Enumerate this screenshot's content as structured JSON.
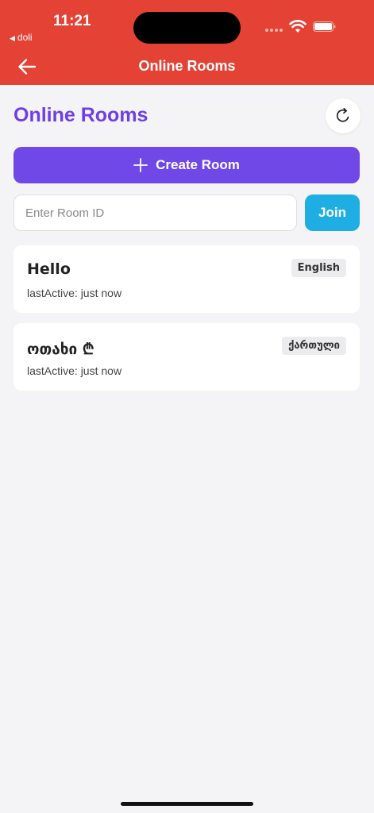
{
  "status_bar": {
    "time": "11:21",
    "back_app": "doli"
  },
  "nav": {
    "title": "Online Rooms",
    "back_icon": "arrow-left-icon"
  },
  "page": {
    "title": "Online Rooms",
    "refresh_icon": "refresh-icon"
  },
  "actions": {
    "create_label": "Create Room",
    "room_id_placeholder": "Enter Room ID",
    "room_id_value": "",
    "join_label": "Join"
  },
  "rooms": [
    {
      "name": "Hello",
      "language": "English",
      "last_active": "lastActive: just now"
    },
    {
      "name": "ოთახი ₾",
      "language": "ქართული",
      "last_active": "lastActive: just now"
    }
  ],
  "colors": {
    "header": "#e34234",
    "accent_purple": "#7048e8",
    "join_blue": "#1eaee4",
    "background": "#f4f4f6"
  }
}
